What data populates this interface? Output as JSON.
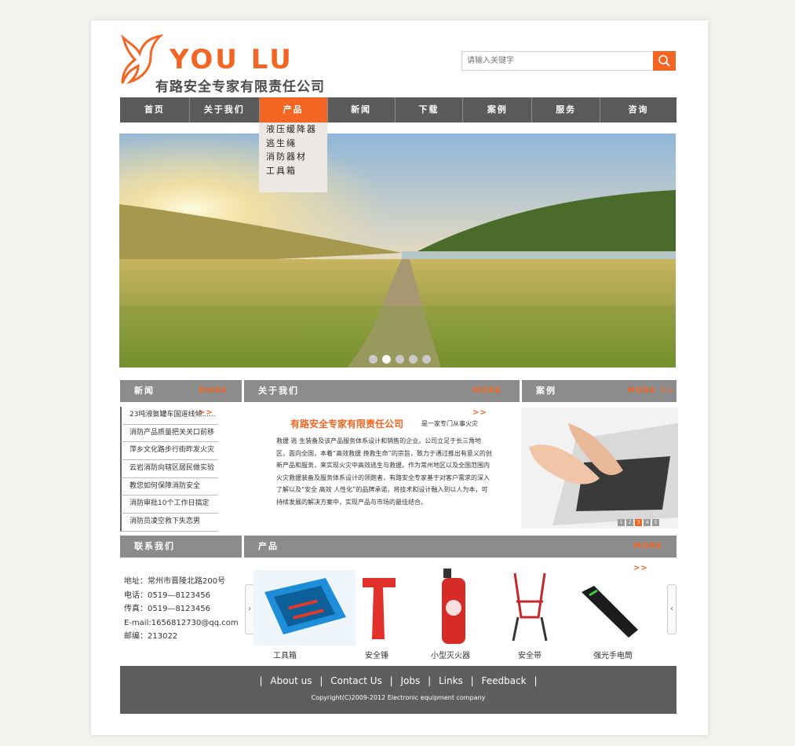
{
  "header": {
    "logo_text": "YOU LU",
    "company_name": "有路安全专家有限责任公司",
    "search_placeholder": "请输入关键字"
  },
  "nav": {
    "items": [
      "首页",
      "关于我们",
      "产品",
      "新闻",
      "下载",
      "案例",
      "服务",
      "咨询"
    ],
    "active": "产品",
    "dropdown": [
      "液压缓降器",
      "逃生绳",
      "消防器材",
      "工具箱"
    ]
  },
  "banner": {
    "dots": 5,
    "active_dot": 2
  },
  "sections": {
    "news_title": "新闻",
    "about_title": "关于我们",
    "case_title": "案例",
    "contact_title": "联系我们",
    "products_title": "产品",
    "more_label": "MORE >>"
  },
  "news": [
    "23吨液氨罐车国道线倾......",
    "消防产品质量把关关口前移",
    "萍乡文化路步行街昨发火灾",
    "云岩消防向辖区居民做实验",
    "教您如何保障消防安全",
    "消防审批10个工作日搞定",
    "消防员凌空救下失恋男"
  ],
  "about": {
    "headline": "有路安全专家有限责任公司",
    "headline_suffix": "是一家专门从事火灾",
    "body": "救援 逃 生装备及该产品服务体系设计和销售的企业。公司立足于长三角地区，面向全国，本着“高效救援 挽救生命”的宗旨，致力于通过推出有意义的创新产品和服务，来实现火灾中高效逃生与救援。作为常州地区以及全国范围内火灾救援装备及服务体系设计的领跑者，有路安全专家基于对客户需求的深入了解以及“安全 高效 人性化”的品牌承诺，将技术和设计融入到以人为本，可持续发展的解决方案中，实现产品与市场的最佳结合。"
  },
  "case_pager": [
    "1",
    "2",
    "3",
    "4",
    "5"
  ],
  "contact": {
    "address": "地址：常州市晋陵北路200号",
    "phone": "电话：0519—8123456",
    "fax": "传真：0519—8123456",
    "email": "E-mail:1656812730@qq.com",
    "postcode": "邮编：213022"
  },
  "products": [
    "工具箱",
    "安全锤",
    "小型灭火器",
    "安全带",
    "强光手电筒"
  ],
  "footer": {
    "links": [
      "About us",
      "Contact Us",
      "Jobs",
      "Links",
      "Feedback"
    ],
    "copyright": "Copyright(C)2009-2012 Electronic equipment company"
  },
  "colors": {
    "accent": "#f26522",
    "nav_bg": "#5a5a5a",
    "bar_bg": "#8c8c8c"
  }
}
